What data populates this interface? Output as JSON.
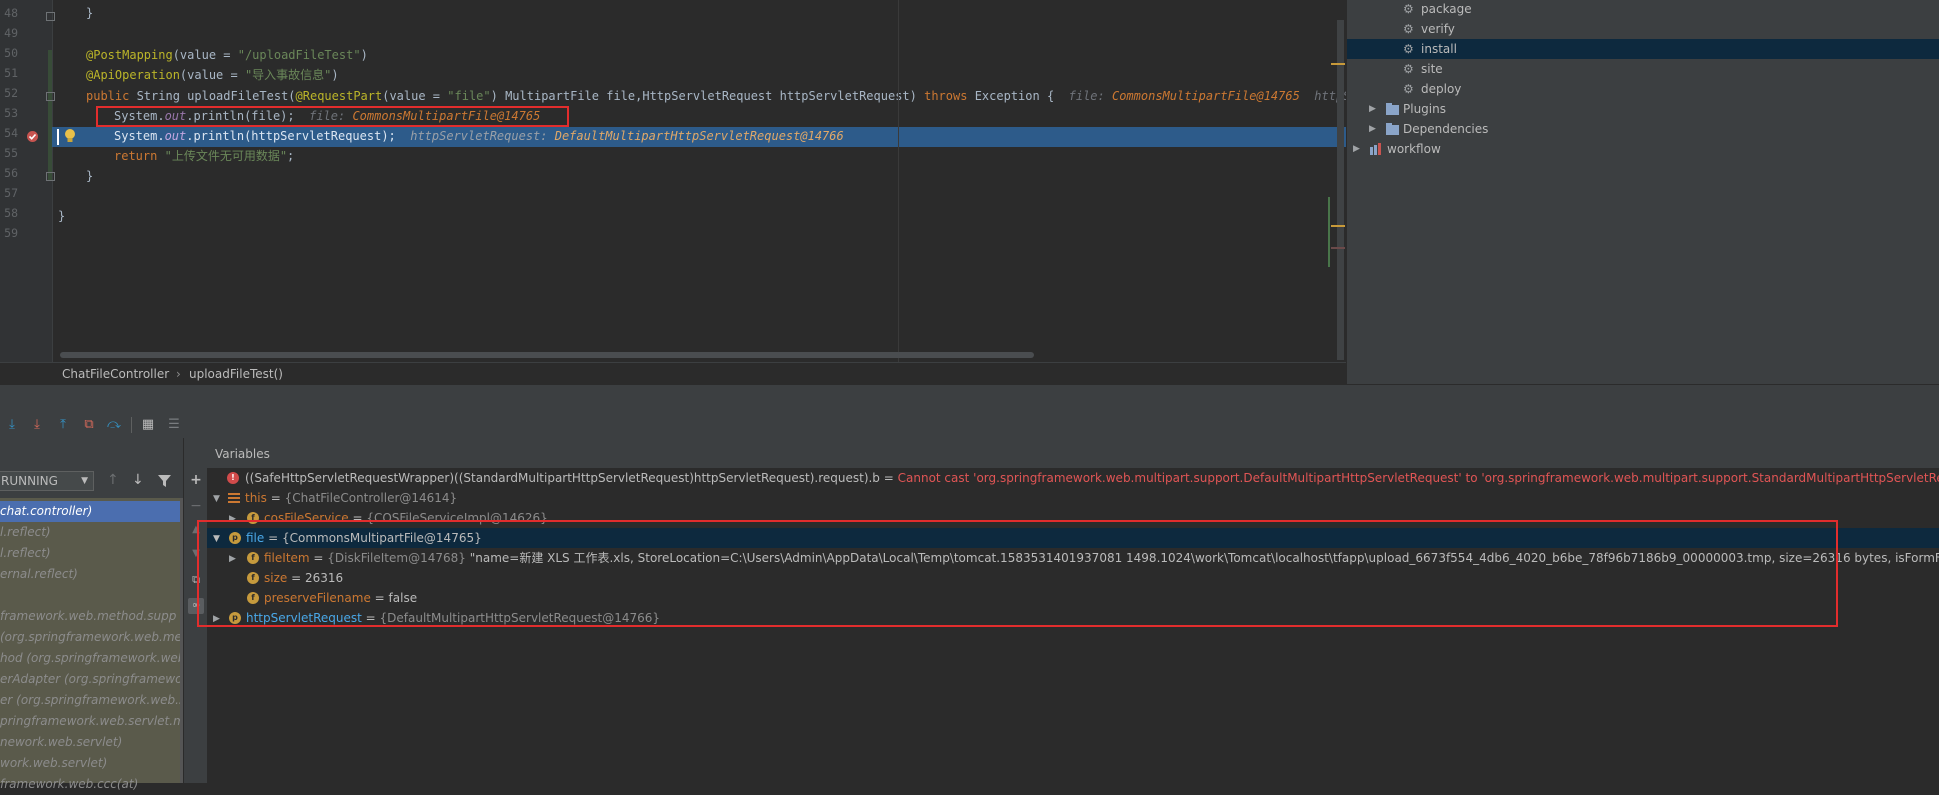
{
  "editor": {
    "line_numbers": [
      "48",
      "49",
      "50",
      "51",
      "52",
      "53",
      "54",
      "55",
      "56",
      "57",
      "58",
      "59"
    ],
    "lines": {
      "l48": "}",
      "l50_ann": "@PostMapping",
      "l50_rest_a": "(value = ",
      "l50_str": "\"/uploadFileTest\"",
      "l50_rest_b": ")",
      "l51_ann": "@ApiOperation",
      "l51_rest_a": "(value = ",
      "l51_str": "\"导入事故信息\"",
      "l51_rest_b": ")",
      "l52_kw": "public",
      "l52_a": " String uploadFileTest(",
      "l52_ann": "@RequestPart",
      "l52_b": "(value = ",
      "l52_str": "\"file\"",
      "l52_c": ") MultipartFile file,HttpServletRequest httpServletRequest) ",
      "l52_kw2": "throws",
      "l52_d": " Exception {",
      "l52_inl_label": "file: ",
      "l52_inl_val": "CommonsMultipartFile@14765",
      "l52_inl_label2": "httpServle",
      "l53_a": "System.",
      "l53_fld": "out",
      "l53_b": ".println(file);",
      "l53_inl_label": "file: ",
      "l53_inl_val": "CommonsMultipartFile@14765",
      "l54_a": "System.",
      "l54_fld": "out",
      "l54_b": ".println(httpServletRequest);",
      "l54_inl_label": "httpServletRequest: ",
      "l54_inl_val": "DefaultMultipartHttpServletRequest@14766",
      "l55_kw": "return",
      "l55_str": "\"上传文件无可用数据\"",
      "l55_end": ";",
      "l56": "}",
      "l58": "}"
    }
  },
  "breadcrumb": {
    "class_name": "ChatFileController",
    "separator": "›",
    "method_name": "uploadFileTest()"
  },
  "maven": {
    "items": [
      {
        "label": "package",
        "icon": "gear-icon"
      },
      {
        "label": "verify",
        "icon": "gear-icon"
      },
      {
        "label": "install",
        "icon": "gear-icon",
        "selected": true
      },
      {
        "label": "site",
        "icon": "gear-icon"
      },
      {
        "label": "deploy",
        "icon": "gear-icon"
      },
      {
        "label": "Plugins",
        "icon": "folder-icon"
      },
      {
        "label": "Dependencies",
        "icon": "folder-icon"
      },
      {
        "label": "workflow",
        "icon": "maven-module-icon"
      }
    ]
  },
  "debugger": {
    "thread_state": "RUNNING",
    "variables_title": "Variables",
    "frames": [
      {
        "text": "chat.controller)",
        "selected": true
      },
      {
        "text": "l.reflect)"
      },
      {
        "text": "l.reflect)"
      },
      {
        "text": "ernal.reflect)"
      },
      {
        "text": ""
      },
      {
        "text": "framework.web.method.supp"
      },
      {
        "text": "(org.springframework.web.meth"
      },
      {
        "text": "hod (org.springframework.web"
      },
      {
        "text": "erAdapter (org.springframewo"
      },
      {
        "text": "er (org.springframework.web.s"
      },
      {
        "text": "pringframework.web.servlet.mvc"
      },
      {
        "text": "nework.web.servlet)"
      },
      {
        "text": "work.web.servlet)"
      },
      {
        "text": "framework.web.ccc(at)"
      }
    ],
    "vars": {
      "error_expr": "((SafeHttpServletRequestWrapper)((StandardMultipartHttpServletRequest)httpServletRequest).request).b = ",
      "error_msg": "Cannot cast 'org.springframework.web.multipart.support.DefaultMultipartHttpServletRequest' to 'org.springframework.web.multipart.support.StandardMultipartHttpServletRequest'",
      "this_name": "this",
      "this_val": "{ChatFileController@14614}",
      "cos_name": "cosFileService",
      "cos_val": "{COSFileServiceImpl@14626}",
      "file_name": "file",
      "file_val": "{CommonsMultipartFile@14765}",
      "fileitem_name": "fileItem",
      "fileitem_type": "{DiskFileItem@14768}",
      "fileitem_val": "\"name=新建 XLS 工作表.xls, StoreLocation=C:\\Users\\Admin\\AppData\\Local\\Temp\\tomcat.1583531401937081 1498.1024\\work\\Tomcat\\localhost\\tfapp\\upload_6673f554_4db6_4020_b6be_78f96b7186b9_00000003.tmp, size=26316 bytes, isFormField=false, Fie",
      "size_name": "size",
      "size_val": "26316",
      "preserve_name": "preserveFilename",
      "preserve_val": "false",
      "req_name": "httpServletRequest",
      "req_val": "{DefaultMultipartHttpServletRequest@14766}",
      "eq": " = "
    }
  },
  "colors": {
    "editor_bg": "#2b2b2b",
    "panel_bg": "#3c3f41",
    "keyword": "#cc7832",
    "string": "#6a8759",
    "annotation": "#bbb529",
    "highlight_line": "#2d5b8a",
    "error_text": "#e05555",
    "red_box": "#e22d2d",
    "selected_row": "#0d293e"
  }
}
